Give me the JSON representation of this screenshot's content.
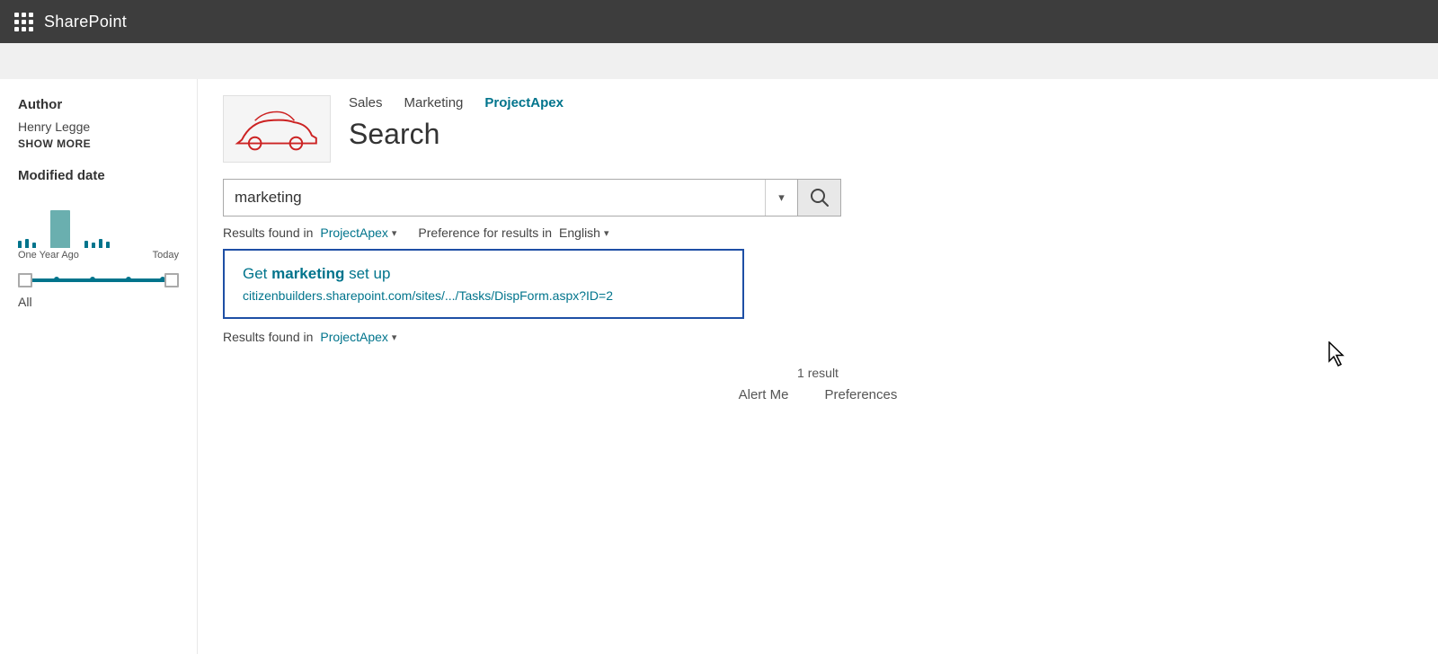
{
  "topNav": {
    "appTitle": "SharePoint"
  },
  "siteNav": {
    "links": [
      {
        "label": "Sales",
        "active": false
      },
      {
        "label": "Marketing",
        "active": false
      },
      {
        "label": "ProjectApex",
        "active": true
      }
    ]
  },
  "pageTitle": "Search",
  "searchBar": {
    "value": "marketing",
    "placeholder": "Search...",
    "dropdownLabel": "▾",
    "goLabel": "🔍"
  },
  "filterBar": {
    "left": "Results found in  ProjectApex",
    "leftArrow": "▾",
    "right": "Preference for results in  English",
    "rightArrow": "▾"
  },
  "results": [
    {
      "titlePrefix": "Get ",
      "titleBold": "marketing",
      "titleSuffix": " set up",
      "url": "citizenbuilders.sharepoint.com/sites/.../Tasks/DispForm.aspx?ID=2"
    }
  ],
  "secondFilter": {
    "label": "Results found in  ProjectApex",
    "arrow": "▾"
  },
  "resultCount": "1 result",
  "bottomLinks": {
    "alertMe": "Alert Me",
    "preferences": "Preferences"
  },
  "sidebar": {
    "authorTitle": "Author",
    "authorName": "Henry Legge",
    "showMore": "SHOW MORE",
    "modifiedTitle": "Modified date",
    "chartLabels": {
      "left": "One Year Ago",
      "right": "Today"
    },
    "allLabel": "All"
  }
}
